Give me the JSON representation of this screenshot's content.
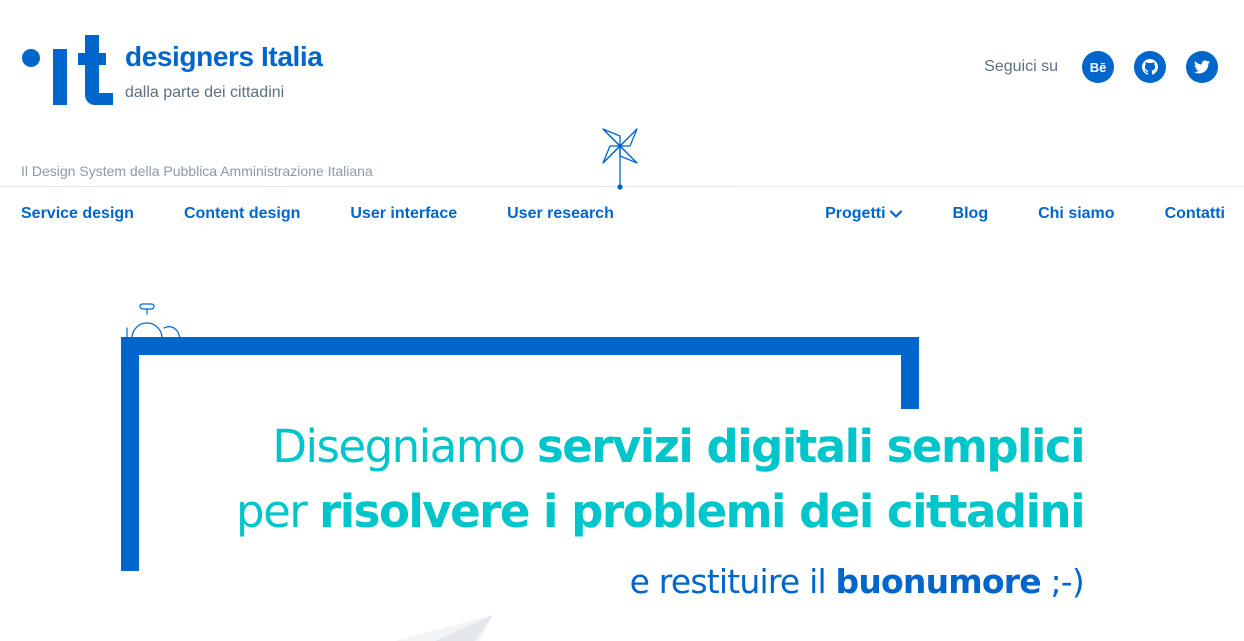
{
  "brand": {
    "name": "designers Italia",
    "tagline": "dalla parte dei cittadini",
    "color": "#0066cc"
  },
  "social": {
    "label": "Seguici su",
    "links": [
      {
        "name": "behance",
        "icon": "behance-icon",
        "glyph": "Bē"
      },
      {
        "name": "github",
        "icon": "github-icon"
      },
      {
        "name": "twitter",
        "icon": "twitter-icon"
      }
    ]
  },
  "subtitle": "Il Design System della Pubblica Amministrazione Italiana",
  "nav": {
    "left": [
      "Service design",
      "Content design",
      "User interface",
      "User research"
    ],
    "right": {
      "projects": "Progetti",
      "blog": "Blog",
      "about": "Chi siamo",
      "contacts": "Contatti"
    }
  },
  "hero": {
    "line1_light": "Disegniamo ",
    "line1_bold": "servizi digitali semplici",
    "line2_light": "per ",
    "line2_bold": "risolvere i problemi dei cittadini",
    "line3_light": "e restituire il ",
    "line3_bold": "buonumore",
    "line3_end": " ;-)",
    "accent_color": "#00c5ca",
    "primary_color": "#0066cc"
  }
}
